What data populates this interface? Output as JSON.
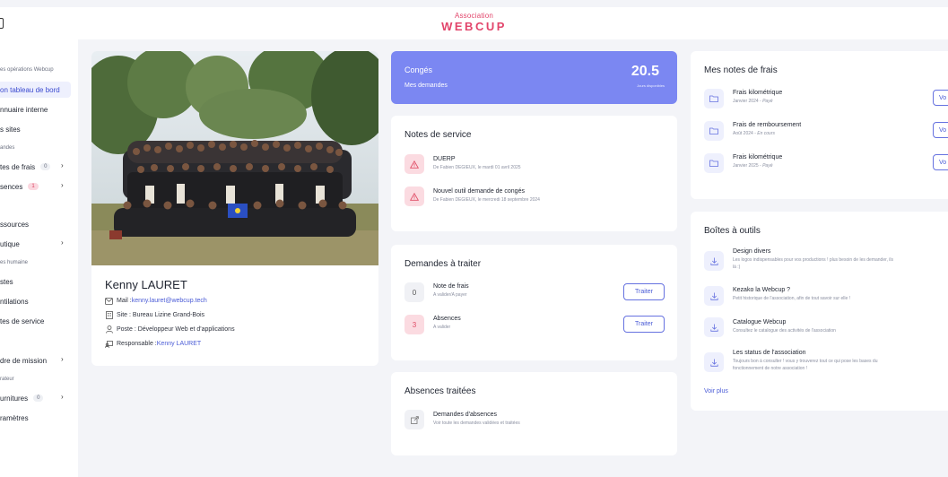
{
  "header": {
    "logo_line1": "Association",
    "logo_line2": "WEBCUP"
  },
  "sidebar": {
    "items": [
      {
        "label": "es opérations Webcup",
        "small": true
      },
      {
        "label": "on tableau de bord",
        "active": true
      },
      {
        "label": "nnuaire interne"
      },
      {
        "label": "s sites"
      },
      {
        "label": "andes",
        "small": true
      },
      {
        "label": "tes de frais",
        "badge": "0",
        "chevron": true
      },
      {
        "label": "sences",
        "badge": "1",
        "badge_color": "pink",
        "chevron": true
      },
      {
        "label": "ssources"
      },
      {
        "label": "utique",
        "chevron": true
      },
      {
        "label": "es humaine",
        "small": true
      },
      {
        "label": "stes"
      },
      {
        "label": "ntilations"
      },
      {
        "label": "tes de service"
      },
      {
        "label": "dre de mission",
        "chevron": true
      },
      {
        "label": "rateur",
        "small": true
      },
      {
        "label": "urnitures",
        "badge": "0",
        "chevron": true
      },
      {
        "label": "ramètres"
      }
    ]
  },
  "profile": {
    "photo_alt": "group-photo",
    "name": "Kenny LAURET",
    "mail_label": "Mail : ",
    "mail": "kenny.lauret@webcup.tech",
    "site": "Site : Bureau Lizine Grand-Bois",
    "poste": "Poste : Développeur Web et d'applications",
    "responsable_label": "Responsable : ",
    "responsable": "Kenny LAURET"
  },
  "conges": {
    "title": "Congés",
    "subtitle": "Mes demandes",
    "value": "20.5",
    "value_label": "Jours disponibles"
  },
  "notes_service": {
    "title": "Notes de service",
    "items": [
      {
        "title": "DUERP",
        "subtitle": "De Fabien DEGIEUX, le mardi 01 avril 2025"
      },
      {
        "title": "Nouvel outil demande de congés",
        "subtitle": "De Fabien DEGIEUX, le mercredi 18 septembre 2024"
      }
    ]
  },
  "demandes": {
    "title": "Demandes à traiter",
    "items": [
      {
        "count": "0",
        "title": "Note de frais",
        "subtitle": "A valider/A payer",
        "button": "Traiter"
      },
      {
        "count": "3",
        "title": "Absences",
        "subtitle": "A valider",
        "button": "Traiter"
      }
    ]
  },
  "absences": {
    "title": "Absences traitées",
    "item_title": "Demandes d'absences",
    "item_subtitle": "Voir toute les demandes validées et traitées"
  },
  "notes_frais": {
    "title": "Mes notes de frais",
    "items": [
      {
        "title": "Frais kilométrique",
        "date": "Janvier 2024",
        "sep": " - ",
        "status": "Payé",
        "button": "Vo"
      },
      {
        "title": "Frais de remboursement",
        "date": "Août 2024",
        "sep": " - ",
        "status": "En cours",
        "button": "Vo"
      },
      {
        "title": "Frais kilométrique",
        "date": "Janvier 2025",
        "sep": " - ",
        "status": "Payé",
        "button": "Vo"
      }
    ]
  },
  "outils": {
    "title": "Boîtes à outils",
    "items": [
      {
        "title": "Design divers",
        "line1": "Les logos indispensables pour vos productions ! plus besoin de les demander, ils",
        "line2": "là :)"
      },
      {
        "title": "Kezako la Webcup ?",
        "line1": "Petit historique de l'association, afin de tout savoir sur elle !",
        "line2": ""
      },
      {
        "title": "Catalogue Webcup",
        "line1": "Consultez le catalogue des activités de l'association",
        "line2": ""
      },
      {
        "title": "Les status de l'association",
        "line1": "Toujours bon à consulter ! vous y trouverez tout ce qui pose les bases du",
        "line2": "fonctionnement de notre association !"
      }
    ],
    "more": "Voir plus"
  }
}
